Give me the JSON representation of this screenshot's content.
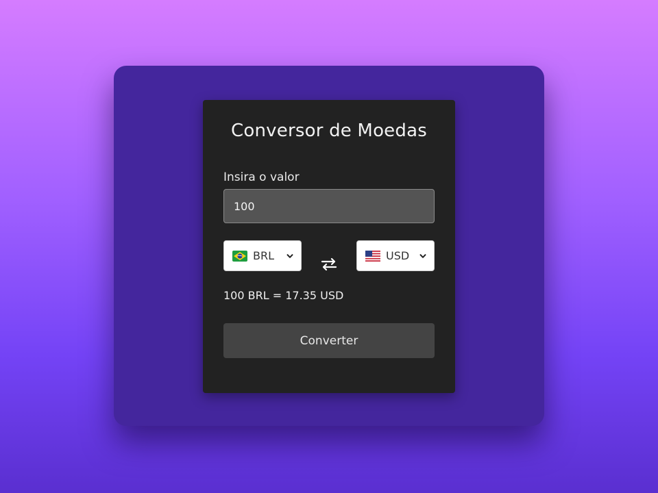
{
  "title": "Conversor de Moedas",
  "amount": {
    "label": "Insira o valor",
    "value": "100"
  },
  "from_currency": {
    "code": "BRL",
    "flag_icon": "brazil-flag-icon"
  },
  "to_currency": {
    "code": "USD",
    "flag_icon": "us-flag-icon"
  },
  "swap_icon": "swap-arrows-icon",
  "result": "100 BRL = 17.35 USD",
  "convert_button": "Converter",
  "colors": {
    "background_top": "#d57cff",
    "background_bottom": "#5a2fd0",
    "outer_card": "#44269d",
    "panel": "#222222",
    "input_bg": "#545454",
    "button_bg": "#444444"
  }
}
